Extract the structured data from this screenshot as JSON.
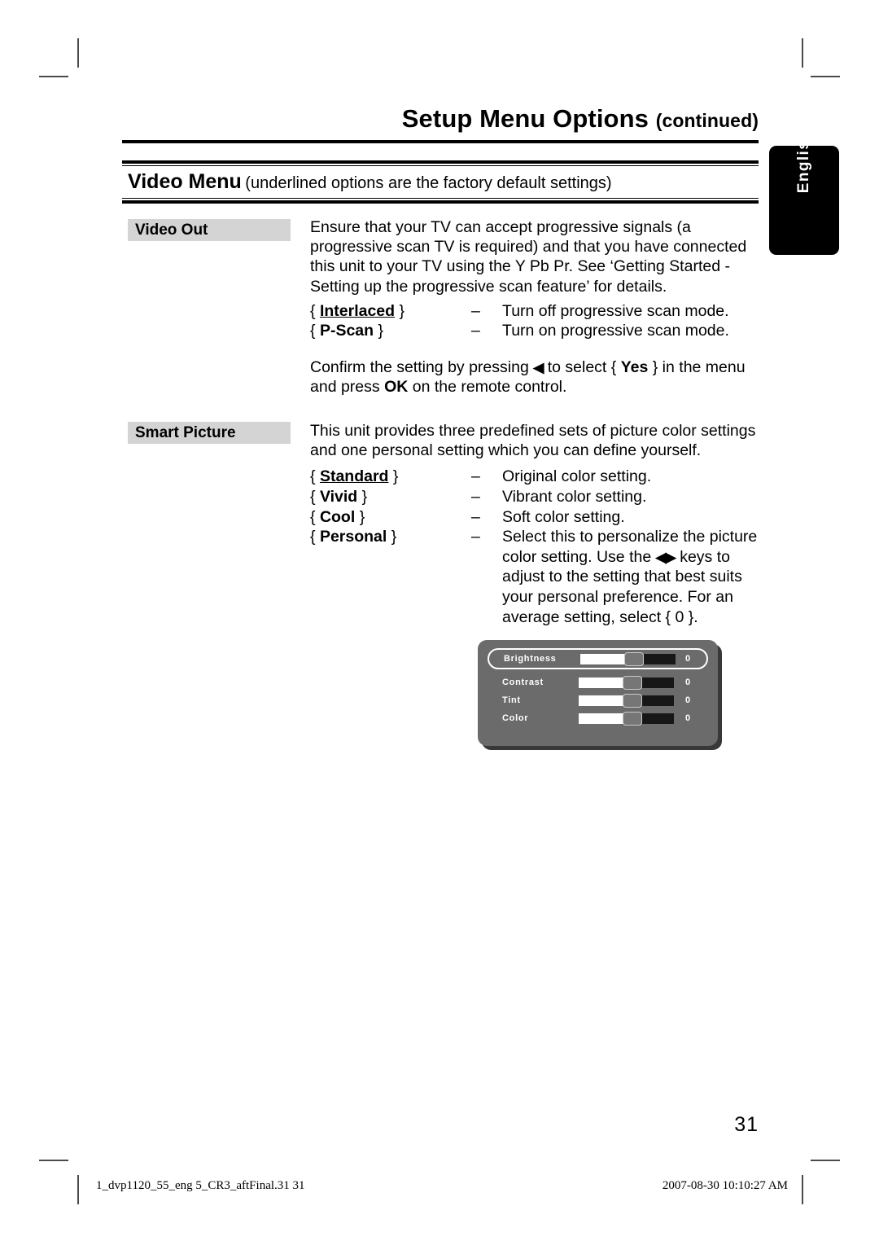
{
  "header": {
    "title": "Setup Menu Options",
    "title_suffix": "(continued)"
  },
  "language_tab": {
    "label": "English"
  },
  "section": {
    "heading": "Video Menu",
    "heading_note": "(underlined options are the factory default settings)"
  },
  "entries": {
    "video_out": {
      "term": "Video Out",
      "intro": "Ensure that your TV can accept progressive signals (a progressive scan TV is required) and that you have connected this unit to your TV using the Y Pb Pr. See ‘Getting Started - Setting up the progressive scan feature’ for details.",
      "options": [
        {
          "open": "{",
          "name": "Interlaced",
          "close": "}",
          "underlined": true,
          "dash": "–",
          "desc": "Turn off progressive scan mode."
        },
        {
          "open": "{",
          "name": "P-Scan",
          "close": "}",
          "underlined": false,
          "dash": "–",
          "desc": "Turn on progressive scan mode."
        }
      ],
      "confirm_1": "Confirm the setting by pressing",
      "confirm_arrow": "◀",
      "confirm_2": "to select {",
      "confirm_yes": "Yes",
      "confirm_3": "} in the menu and press",
      "confirm_ok": "OK",
      "confirm_4": "on the remote control."
    },
    "smart_picture": {
      "term": "Smart Picture",
      "intro": "This unit provides three predefined sets of picture color settings and one personal setting which you can define yourself.",
      "options": [
        {
          "open": "{",
          "name": "Standard",
          "close": "}",
          "underlined": true,
          "dash": "–",
          "desc": "Original color setting."
        },
        {
          "open": "{",
          "name": "Vivid",
          "close": "}",
          "underlined": false,
          "dash": "–",
          "desc": "Vibrant color setting."
        },
        {
          "open": "{",
          "name": "Cool",
          "close": "}",
          "underlined": false,
          "dash": "–",
          "desc": "Soft color setting."
        }
      ],
      "personal": {
        "open": "{",
        "name": "Personal",
        "close": "}",
        "dash": "–",
        "desc_1": "Select this to personalize the picture color setting. Use the",
        "desc_arrows": "◀▶",
        "desc_2": "keys to adjust to the setting that best suits your personal preference. For an average setting, select { 0 }."
      }
    }
  },
  "osd_panel": {
    "rows": [
      {
        "label": "Brightness",
        "value": "0",
        "selected": true
      },
      {
        "label": "Contrast",
        "value": "0",
        "selected": false
      },
      {
        "label": "Tint",
        "value": "0",
        "selected": false
      },
      {
        "label": "Color",
        "value": "0",
        "selected": false
      }
    ],
    "panel_color": "#6b6b6b",
    "highlight_color": "#ffffff"
  },
  "page_number": "31",
  "footer": {
    "left": "1_dvp1120_55_eng 5_CR3_aftFinal.31   31",
    "right": "2007-08-30   10:10:27 AM"
  }
}
